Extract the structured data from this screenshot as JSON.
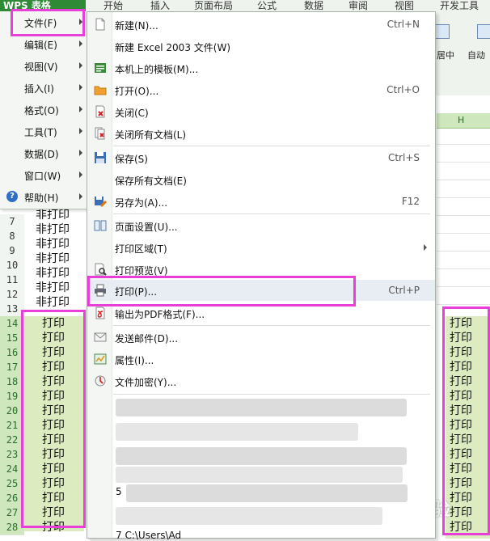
{
  "app": {
    "title": "WPS 表格"
  },
  "ribbon": {
    "tabs": [
      "开始",
      "插入",
      "页面布局",
      "公式",
      "数据",
      "审阅",
      "视图",
      "开发工具"
    ],
    "merge_label": "居中",
    "autowrap_label": "自动"
  },
  "menu": [
    {
      "label": "文件(F)",
      "active": true
    },
    {
      "label": "编辑(E)"
    },
    {
      "label": "视图(V)"
    },
    {
      "label": "插入(I)"
    },
    {
      "label": "格式(O)"
    },
    {
      "label": "工具(T)"
    },
    {
      "label": "数据(D)"
    },
    {
      "label": "窗口(W)"
    },
    {
      "label": "帮助(H)"
    }
  ],
  "file_menu": {
    "new": {
      "label": "新建(N)...",
      "shortcut": "Ctrl+N"
    },
    "new2003": {
      "label": "新建 Excel 2003 文件(W)"
    },
    "templates": {
      "label": "本机上的模板(M)..."
    },
    "open": {
      "label": "打开(O)...",
      "shortcut": "Ctrl+O"
    },
    "close": {
      "label": "关闭(C)"
    },
    "close_all": {
      "label": "关闭所有文档(L)"
    },
    "save": {
      "label": "保存(S)",
      "shortcut": "Ctrl+S"
    },
    "save_all": {
      "label": "保存所有文档(E)"
    },
    "save_as": {
      "label": "另存为(A)...",
      "shortcut": "F12"
    },
    "page_setup": {
      "label": "页面设置(U)..."
    },
    "print_area": {
      "label": "打印区域(T)"
    },
    "print_preview": {
      "label": "打印预览(V)"
    },
    "print": {
      "label": "打印(P)...",
      "shortcut": "Ctrl+P"
    },
    "export_pdf": {
      "label": "输出为PDF格式(F)..."
    },
    "send_mail": {
      "label": "发送邮件(D)..."
    },
    "properties": {
      "label": "属性(I)..."
    },
    "encrypt": {
      "label": "文件加密(Y)..."
    },
    "recent_5_prefix": "5",
    "recent_7": "7 C:\\Users\\Ad"
  },
  "sheet": {
    "col_h": "H",
    "non_print": "非打印",
    "print": "打印",
    "rows": [
      "7",
      "8",
      "9",
      "10",
      "11",
      "12",
      "13",
      "14",
      "15",
      "16",
      "17",
      "18",
      "19",
      "20",
      "21",
      "22",
      "23",
      "24",
      "25",
      "26",
      "27",
      "28"
    ]
  },
  "watermark": "Bai 经验"
}
